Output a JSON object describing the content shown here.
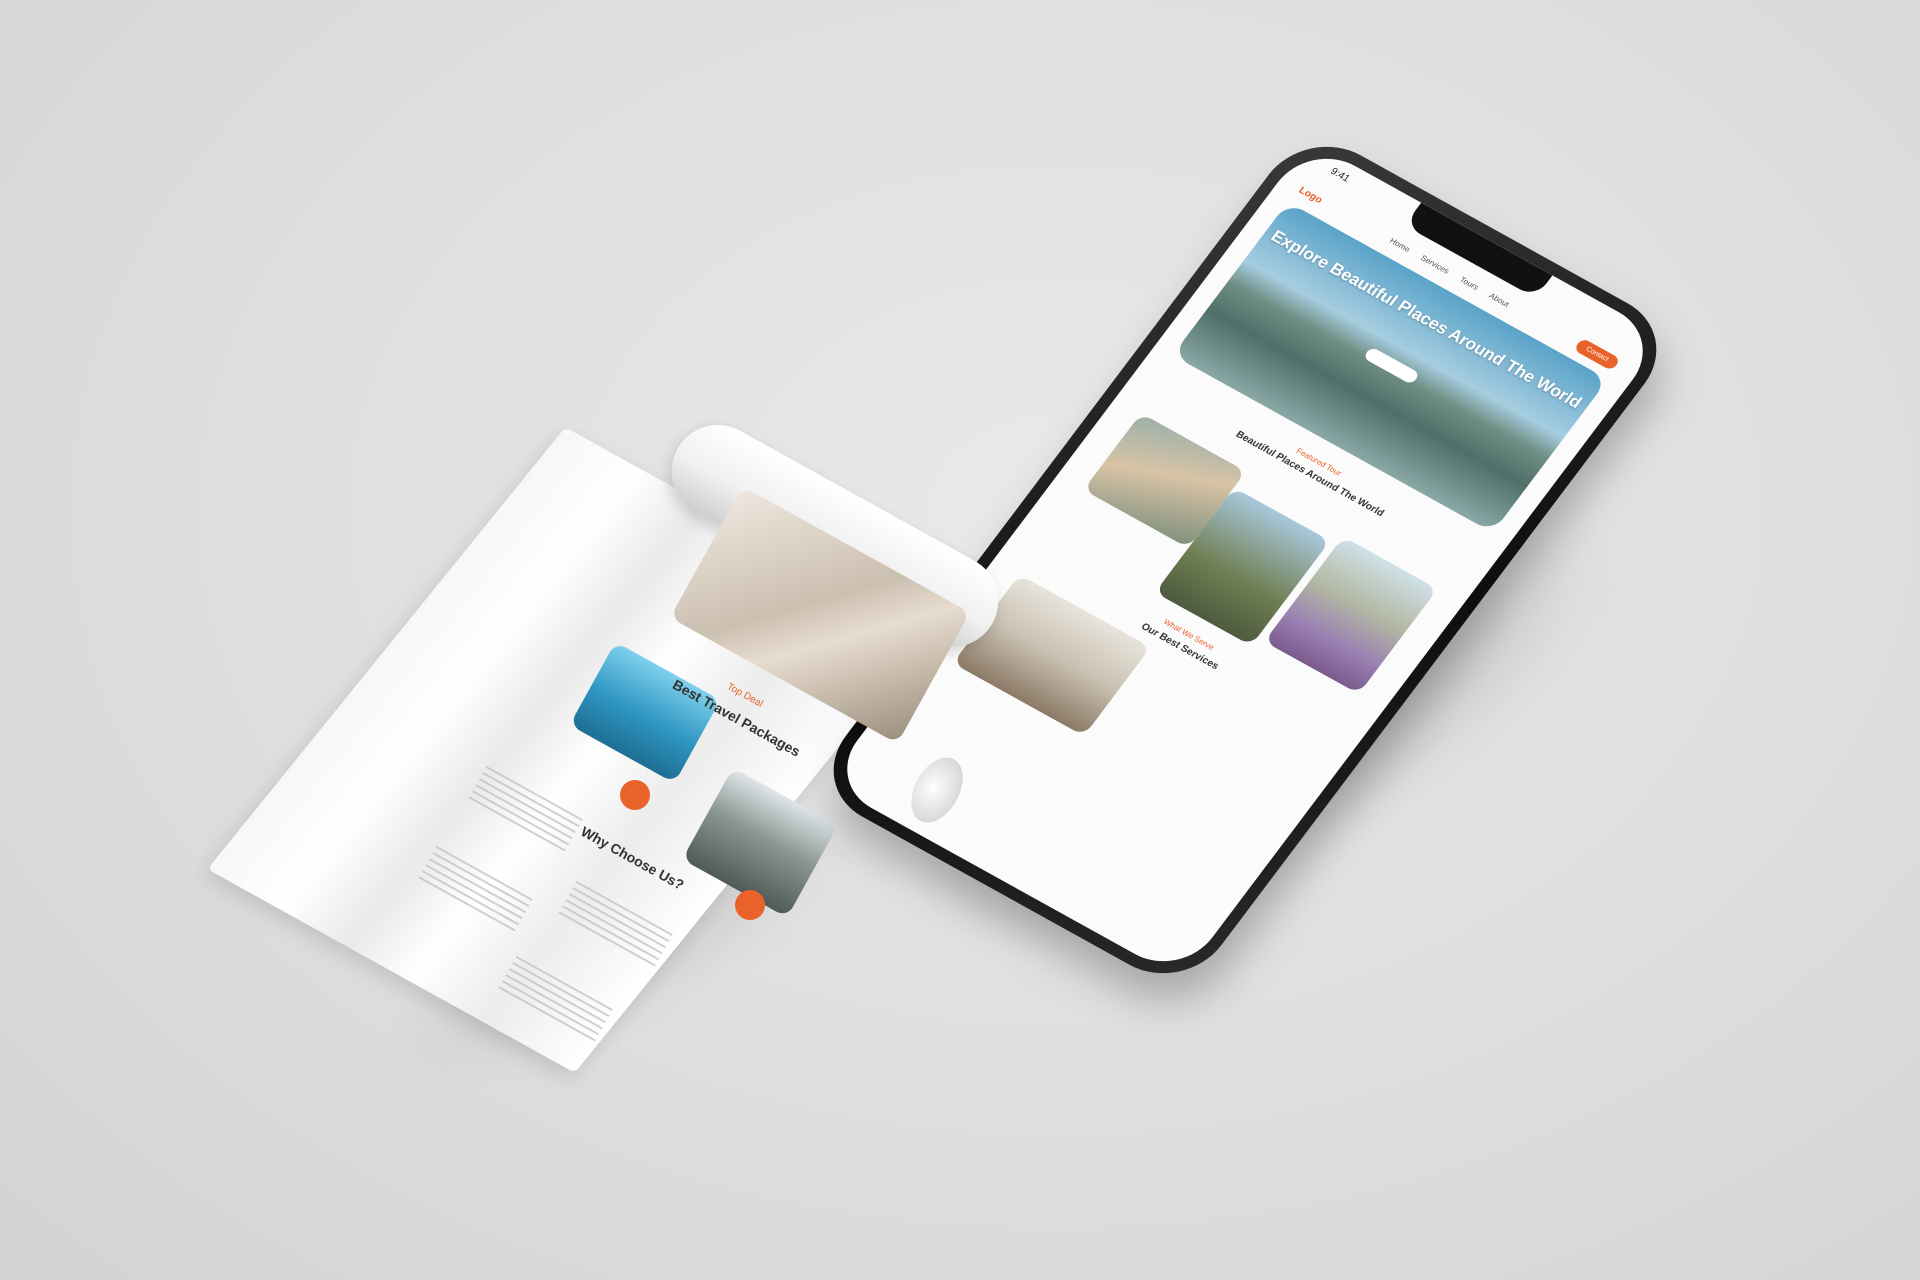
{
  "phone": {
    "status_time": "9:41",
    "nav": {
      "logo": "Logo",
      "menu": [
        "Home",
        "Services",
        "Tours",
        "About"
      ],
      "cta": "Contact"
    },
    "hero": {
      "title": "Explore Beautiful Places Around The World"
    },
    "sections": {
      "featured_tag": "Featured Tour",
      "featured_title": "Beautiful Places Around The World",
      "services_tag": "What We Serve",
      "services_title": "Our Best Services"
    }
  },
  "paper": {
    "packages_tag": "Top Deal",
    "packages_title": "Best Travel Packages",
    "why_title": "Why Choose Us?"
  },
  "colors": {
    "accent": "#e8622a",
    "background": "#e2e2e2",
    "phone_frame": "#151515"
  }
}
